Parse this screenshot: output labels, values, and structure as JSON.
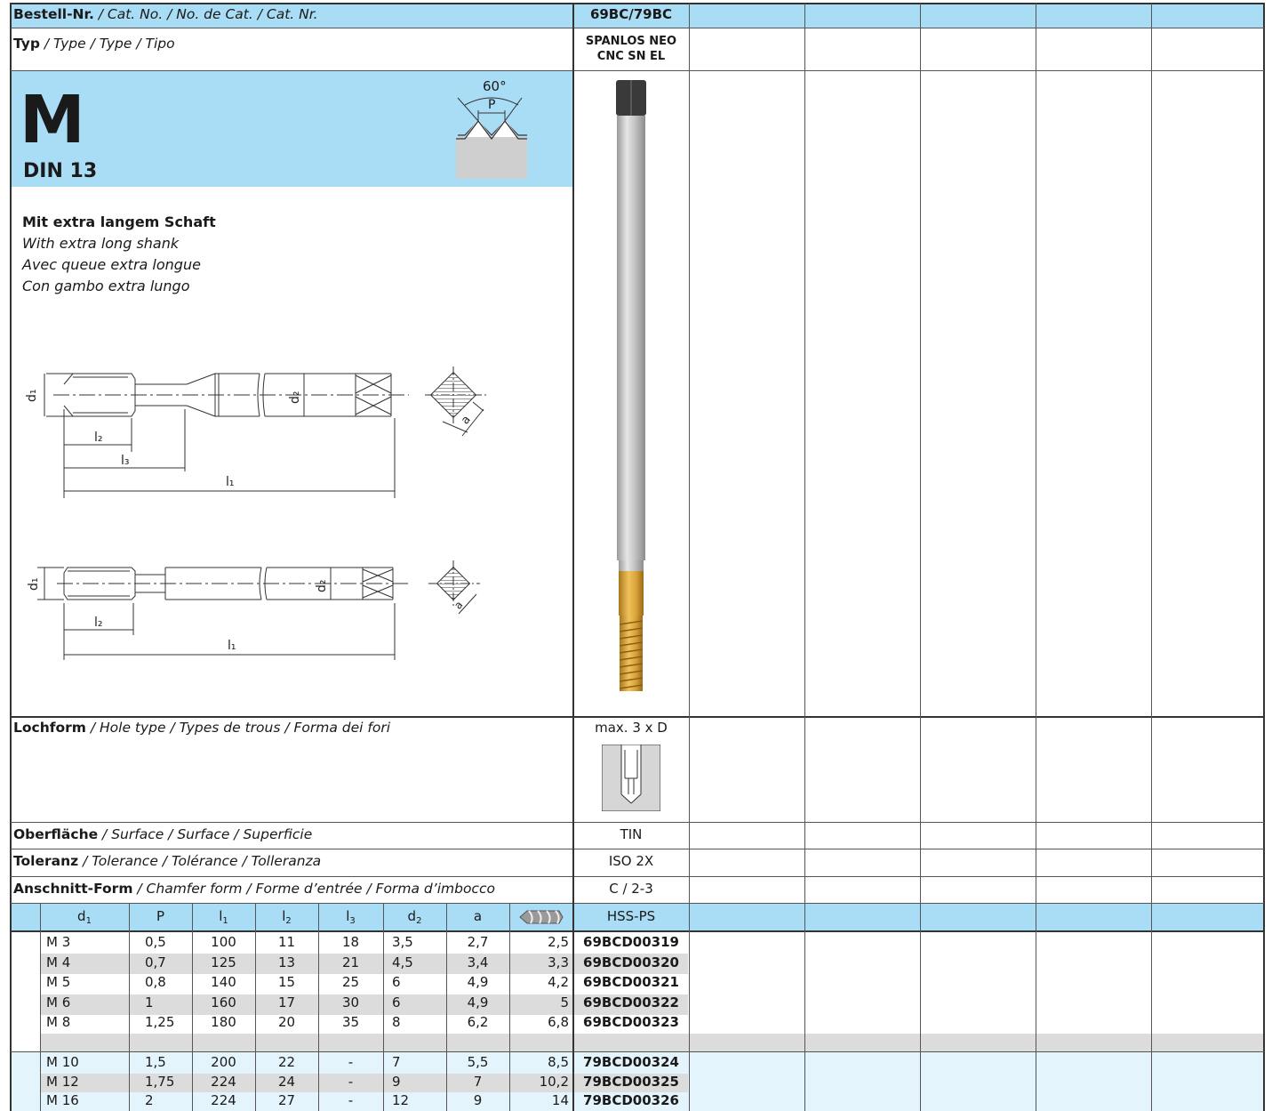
{
  "top_cut_text": "",
  "header": {
    "cat_no_label_bold": "Bestell-Nr.",
    "cat_no_label_rest": " / Cat. No. / No. de Cat. / Cat. Nr.",
    "cat_no_value": "69BC/79BC",
    "type_label_bold": "Typ",
    "type_label_rest": " / Type / Type / Tipo",
    "type_value_line1": "SPANLOS NEO",
    "type_value_line2": "CNC SN EL"
  },
  "thread": {
    "letter": "M",
    "standard": "DIN 13",
    "angle": "60°",
    "pitch": "P"
  },
  "description": {
    "line1": "Mit extra langem Schaft",
    "line2": "With extra long shank",
    "line3": "Avec queue extra longue",
    "line4": "Con gambo extra lungo"
  },
  "drawing_labels": {
    "d1": "d",
    "d2": "d",
    "l1": "l",
    "l2": "l",
    "l3": "l",
    "a": "a",
    "sub1": "1",
    "sub2": "2",
    "sub3": "3"
  },
  "properties": [
    {
      "bold": "Lochform",
      "rest": " / Hole type / Types de trous / Forma dei fori",
      "value": "max. 3 x D"
    },
    {
      "bold": "Oberfläche",
      "rest": " / Surface / Surface / Superficie",
      "value": "TIN"
    },
    {
      "bold": "Toleranz",
      "rest": " / Tolerance / Tolérance / Tolleranza",
      "value": "ISO 2X"
    },
    {
      "bold": "Anschnitt-Form",
      "rest": " / Chamfer form / Forme d’entrée / Forma d’imbocco",
      "value": "C / 2-3"
    }
  ],
  "table": {
    "headers": [
      "d",
      "P",
      "l",
      "l",
      "l",
      "d",
      "a",
      "",
      "HSS-PS"
    ],
    "header_subs": [
      "1",
      "",
      "1",
      "2",
      "3",
      "2",
      "",
      "",
      ""
    ],
    "group1": [
      {
        "d1": "M 3",
        "p": "0,5",
        "l1": "100",
        "l2": "11",
        "l3": "18",
        "d2": "3,5",
        "a": "2,7",
        "drill": "2,5",
        "code": "69BCD00319"
      },
      {
        "d1": "M 4",
        "p": "0,7",
        "l1": "125",
        "l2": "13",
        "l3": "21",
        "d2": "4,5",
        "a": "3,4",
        "drill": "3,3",
        "code": "69BCD00320"
      },
      {
        "d1": "M 5",
        "p": "0,8",
        "l1": "140",
        "l2": "15",
        "l3": "25",
        "d2": "6",
        "a": "4,9",
        "drill": "4,2",
        "code": "69BCD00321"
      },
      {
        "d1": "M 6",
        "p": "1",
        "l1": "160",
        "l2": "17",
        "l3": "30",
        "d2": "6",
        "a": "4,9",
        "drill": "5",
        "code": "69BCD00322"
      },
      {
        "d1": "M 8",
        "p": "1,25",
        "l1": "180",
        "l2": "20",
        "l3": "35",
        "d2": "8",
        "a": "6,2",
        "drill": "6,8",
        "code": "69BCD00323"
      }
    ],
    "group2": [
      {
        "d1": "M 10",
        "p": "1,5",
        "l1": "200",
        "l2": "22",
        "l3": "-",
        "d2": "7",
        "a": "5,5",
        "drill": "8,5",
        "code": "79BCD00324"
      },
      {
        "d1": "M 12",
        "p": "1,75",
        "l1": "224",
        "l2": "24",
        "l3": "-",
        "d2": "9",
        "a": "7",
        "drill": "10,2",
        "code": "79BCD00325"
      },
      {
        "d1": "M 16",
        "p": "2",
        "l1": "224",
        "l2": "27",
        "l3": "-",
        "d2": "12",
        "a": "9",
        "drill": "14",
        "code": "79BCD00326"
      }
    ]
  },
  "colors": {
    "header_blue": "#a9dcf5",
    "light_blue": "#e3f4fc",
    "row_gray": "#dcdcdc",
    "tin_gold": "#d9a33a"
  }
}
